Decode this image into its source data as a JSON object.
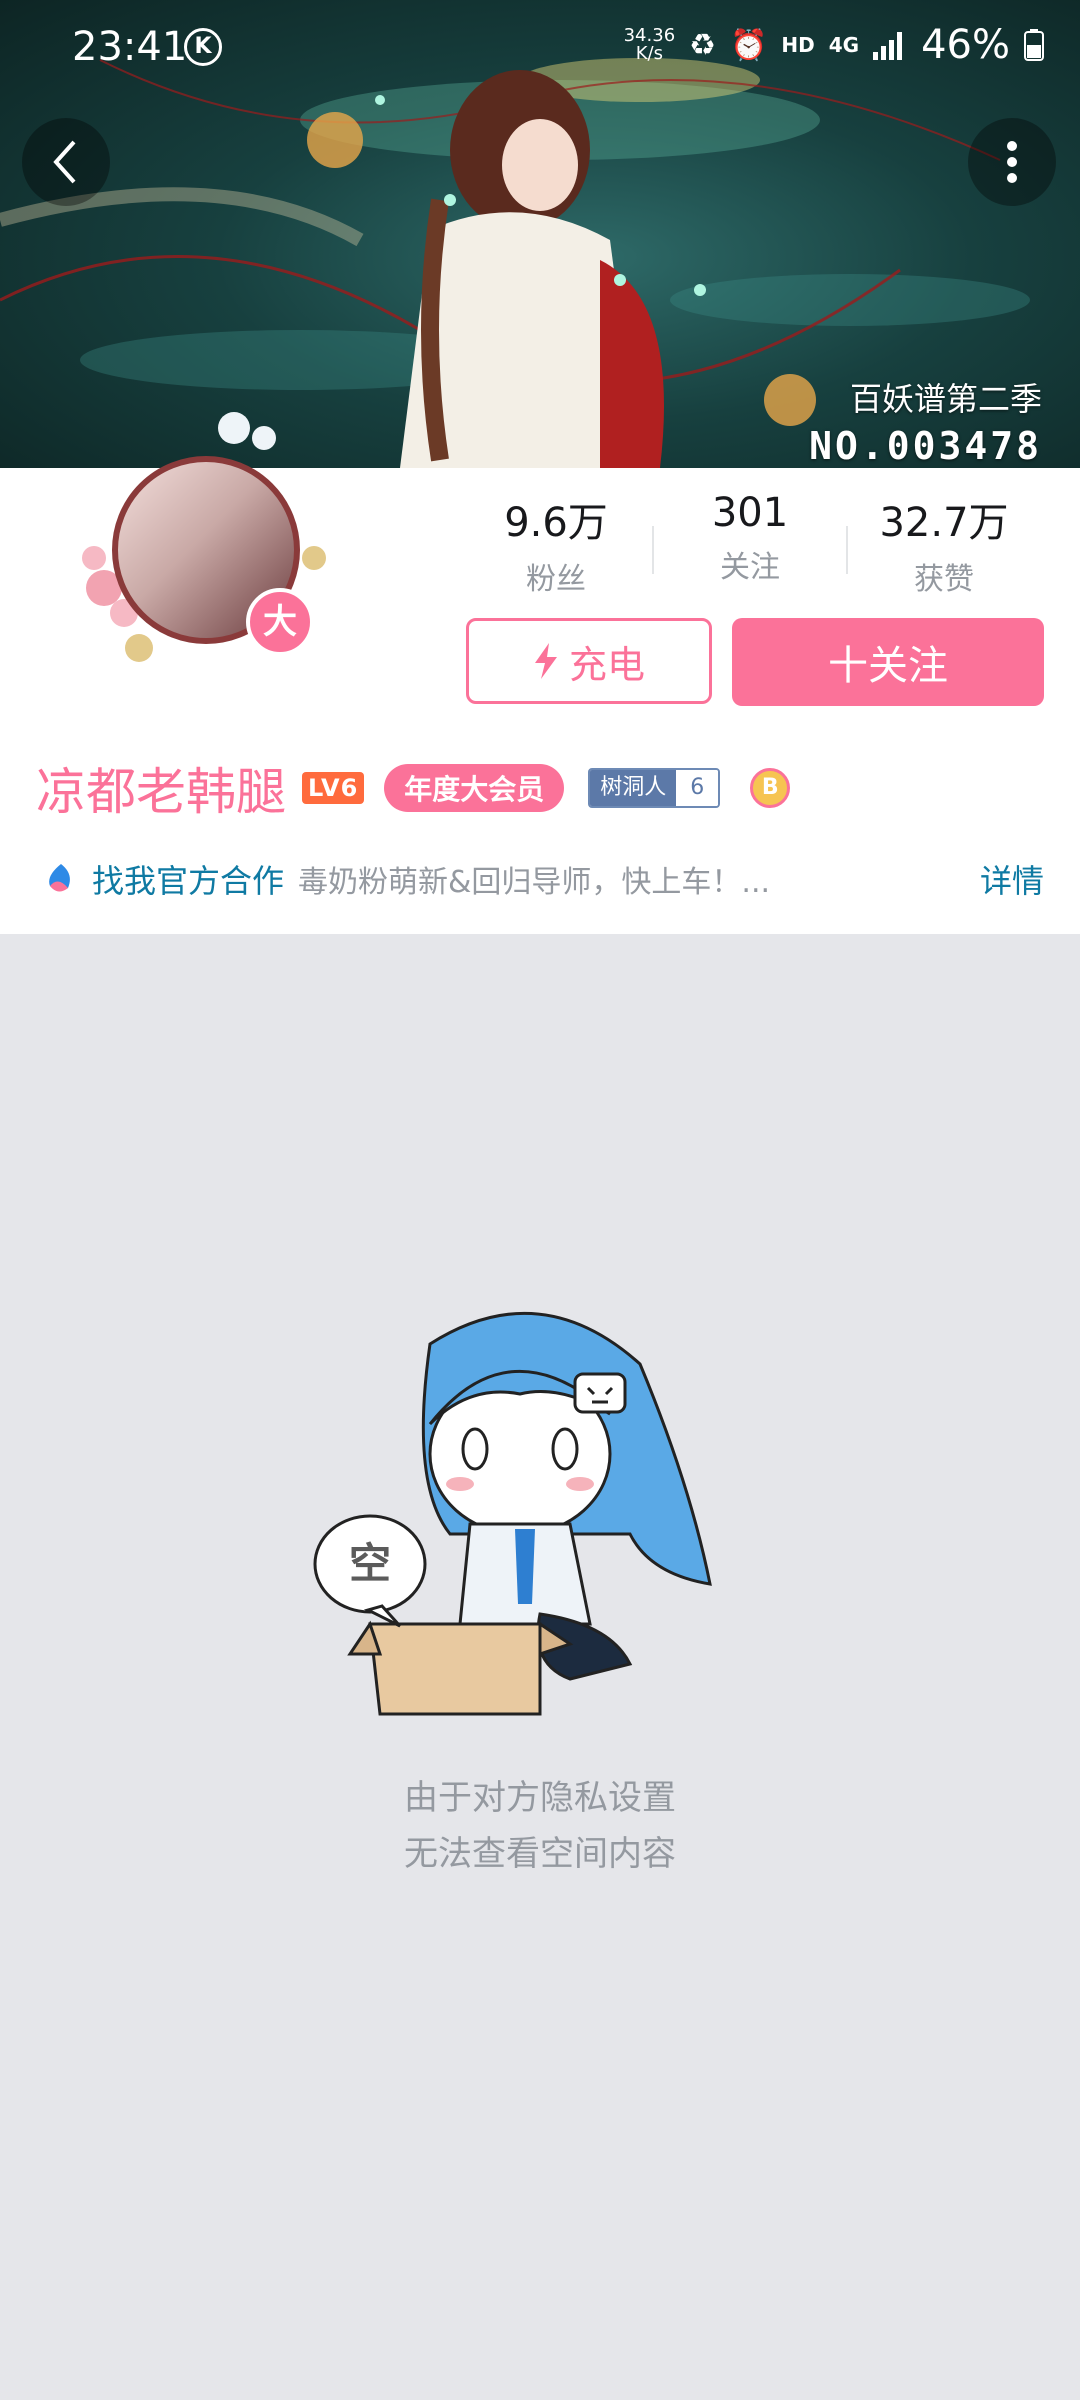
{
  "status_bar": {
    "time": "23:41",
    "k_badge": "K",
    "speed": "34.36\nK/s",
    "hd": "HD",
    "network": "4G",
    "battery": "46%"
  },
  "banner": {
    "title": "百妖谱第二季",
    "number": "NO.003478"
  },
  "profile": {
    "avatar_badge": "大",
    "stats": [
      {
        "value": "9.6万",
        "label": "粉丝"
      },
      {
        "value": "301",
        "label": "关注"
      },
      {
        "value": "32.7万",
        "label": "获赞"
      }
    ],
    "charge_label": "充电",
    "follow_label": "十关注",
    "username": "凉都老韩腿",
    "level": "LV6",
    "vip_label": "年度大会员",
    "tree_label": "树洞人",
    "tree_level": "6",
    "medal": "B",
    "coop_title": "找我官方合作",
    "coop_desc": "毒奶粉萌新&回归导师，快上车！...",
    "coop_detail": "详情"
  },
  "empty": {
    "bubble": "空",
    "line1": "由于对方隐私设置",
    "line2": "无法查看空间内容"
  },
  "colors": {
    "accent": "#fb7299",
    "link": "#0f7aa3",
    "page_bg": "#e5e6ea"
  }
}
